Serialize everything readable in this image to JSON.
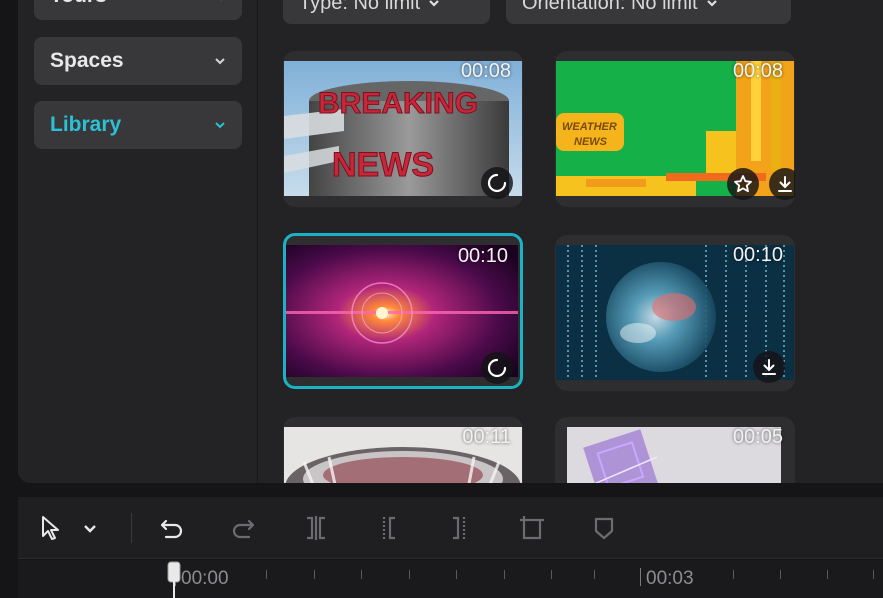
{
  "sidebar": {
    "items": [
      {
        "label": "Tours"
      },
      {
        "label": "Spaces"
      },
      {
        "label": "Library",
        "active": true
      }
    ]
  },
  "filters": {
    "type_label": "Type: No limit",
    "orientation_label": "Orientation: No limit"
  },
  "media": [
    {
      "duration": "00:08",
      "title_line1": "BREAKING",
      "title_line2": "NEWS",
      "action": "loading"
    },
    {
      "duration": "00:08",
      "title_line1": "WEATHER",
      "title_line2": "NEWS",
      "actions": [
        "favorite",
        "download"
      ]
    },
    {
      "duration": "00:10",
      "selected": true,
      "action": "loading"
    },
    {
      "duration": "00:10",
      "action": "download"
    },
    {
      "duration": "00:11"
    },
    {
      "duration": "00:05"
    }
  ],
  "timeline": {
    "ruler_labels": [
      "00:00",
      "00:03"
    ]
  },
  "colors": {
    "accent": "#1cb2c6",
    "panel": "#232326",
    "button": "#38383b"
  }
}
